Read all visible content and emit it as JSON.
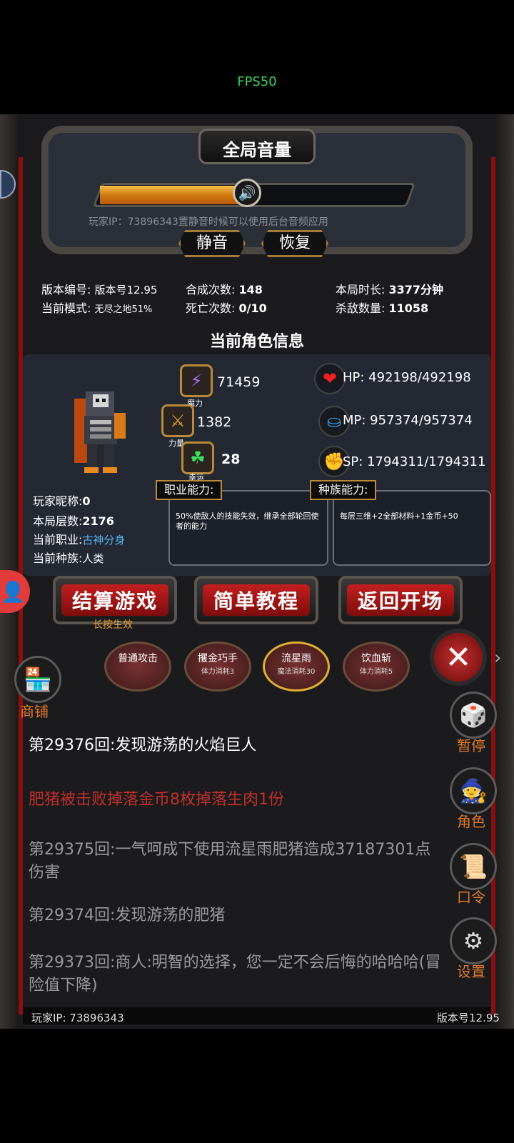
{
  "fps": "FPS50",
  "volume": {
    "title": "全局音量",
    "level_percent": 48,
    "note": "玩家IP：73896343置静音时候可以使用后台音频应用",
    "mute_label": "静音",
    "restore_label": "恢复"
  },
  "stats": {
    "version_label": "版本编号:",
    "version_value": "版本号12.95",
    "mode_label": "当前模式:",
    "mode_value": "无尽之地51%",
    "compose_label": "合成次数:",
    "compose_value": "148",
    "death_label": "死亡次数:",
    "death_value": "0/10",
    "duration_label": "本局时长:",
    "duration_value": "3377分钟",
    "kills_label": "杀敌数量:",
    "kills_value": "11058"
  },
  "character": {
    "section_title": "当前角色信息",
    "magic_value": "71459",
    "magic_caption": "魔力",
    "strength_value": "1382",
    "strength_caption": "力量",
    "luck_value": "28",
    "luck_caption": "幸运",
    "hp": "HP:  492198/492198",
    "mp": "MP:  957374/957374",
    "sp": "SP:  1794311/1794311",
    "nickname_label": "玩家昵称:",
    "nickname_value": "0",
    "floors_label": "本局层数:",
    "floors_value": "2176",
    "job_label": "当前职业:",
    "job_value": "古神分身",
    "race_label": "当前种族:",
    "race_value": "人类",
    "job_ability_tag": "职业能力:",
    "job_ability_text": "50%使敌人的技能失效，继承全部轮回使者的能力",
    "race_ability_tag": "种族能力:",
    "race_ability_text": "每层三维+2全部材料+1金币+50"
  },
  "buttons": {
    "settle": "结算游戏",
    "settle_hint": "长按生效",
    "tutorial": "简单教程",
    "return": "返回开场"
  },
  "skills": [
    {
      "name": "普通攻击",
      "cost": ""
    },
    {
      "name": "攫金巧手",
      "cost": "体力消耗3"
    },
    {
      "name": "流星雨",
      "cost": "魔法消耗30"
    },
    {
      "name": "饮血斩",
      "cost": "体力消耗5"
    }
  ],
  "side": {
    "shop": "商铺",
    "pause": "暂停",
    "role": "角色",
    "code": "口令",
    "settings": "设置"
  },
  "log": [
    {
      "text": "第29376回:发现游荡的火焰巨人",
      "color": "#ffffff"
    },
    {
      "text": "肥猪被击败掉落金币8枚掉落生肉1份",
      "color": "#c0302c"
    },
    {
      "text": "第29375回:一气呵成下使用流星雨肥猪造成37187301点伤害",
      "color": "#9a9a9a"
    },
    {
      "text": "第29374回:发现游荡的肥猪",
      "color": "#9a9a9a"
    },
    {
      "text": "第29373回:商人:明智的选择，您一定不会后悔的哈哈哈(冒险值下降)",
      "color": "#9a9a9a"
    }
  ],
  "footer": {
    "ip": "玩家IP:  73896343",
    "version": "版本号12.95"
  },
  "colors": {
    "accent_gold": "#b88a3a",
    "button_red": "#c21f1f",
    "job_value": "#5ab4f0"
  }
}
